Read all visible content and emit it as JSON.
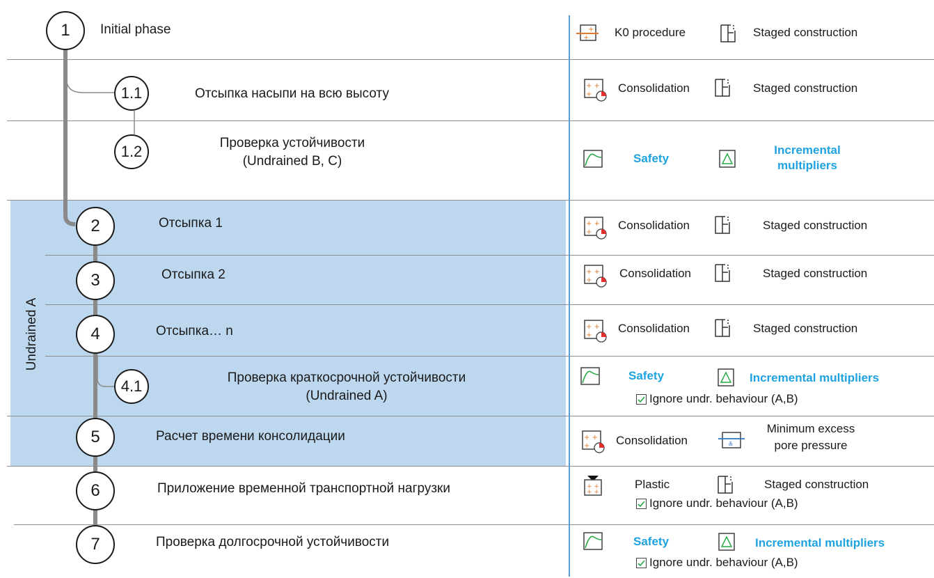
{
  "group_label": "Undrained A",
  "phases": [
    {
      "id": "1",
      "label": "Initial phase"
    },
    {
      "id": "1.1",
      "label": "Отсыпка насыпи на всю высоту"
    },
    {
      "id": "1.2",
      "label_line1": "Проверка устойчивости",
      "label_line2": "(Undrained B, C)"
    },
    {
      "id": "2",
      "label": "Отсыпка 1"
    },
    {
      "id": "3",
      "label": "Отсыпка 2"
    },
    {
      "id": "4",
      "label": "Отсыпка… n"
    },
    {
      "id": "4.1",
      "label_line1": "Проверка краткосрочной устойчивости",
      "label_line2": "(Undrained A)"
    },
    {
      "id": "5",
      "label": "Расчет времени консолидации"
    },
    {
      "id": "6",
      "label": "Приложение временной транспортной нагрузки"
    },
    {
      "id": "7",
      "label": "Проверка долгосрочной устойчивости"
    }
  ],
  "settings": {
    "k0": "K0 procedure",
    "staged": "Staged construction",
    "consolidation": "Consolidation",
    "safety": "Safety",
    "incremental": "Incremental multipliers",
    "incremental_line1": "Incremental",
    "incremental_line2": "multipliers",
    "plastic": "Plastic",
    "min_pore": "Minimum excess pore pressure",
    "ignore_undr": "Ignore undr. behaviour (A,B)"
  },
  "colors": {
    "group_fill": "#bdd7ee",
    "divider": "#5b9bd5",
    "accent_text": "#1ea3e0",
    "icon_orange": "#e07a2e",
    "icon_green": "#27a844"
  },
  "icons": [
    "k0-procedure-icon",
    "staged-construction-icon",
    "consolidation-icon",
    "safety-curve-icon",
    "incremental-multipliers-icon",
    "plastic-icon",
    "min-pore-pressure-icon",
    "checkbox-checked-icon"
  ]
}
